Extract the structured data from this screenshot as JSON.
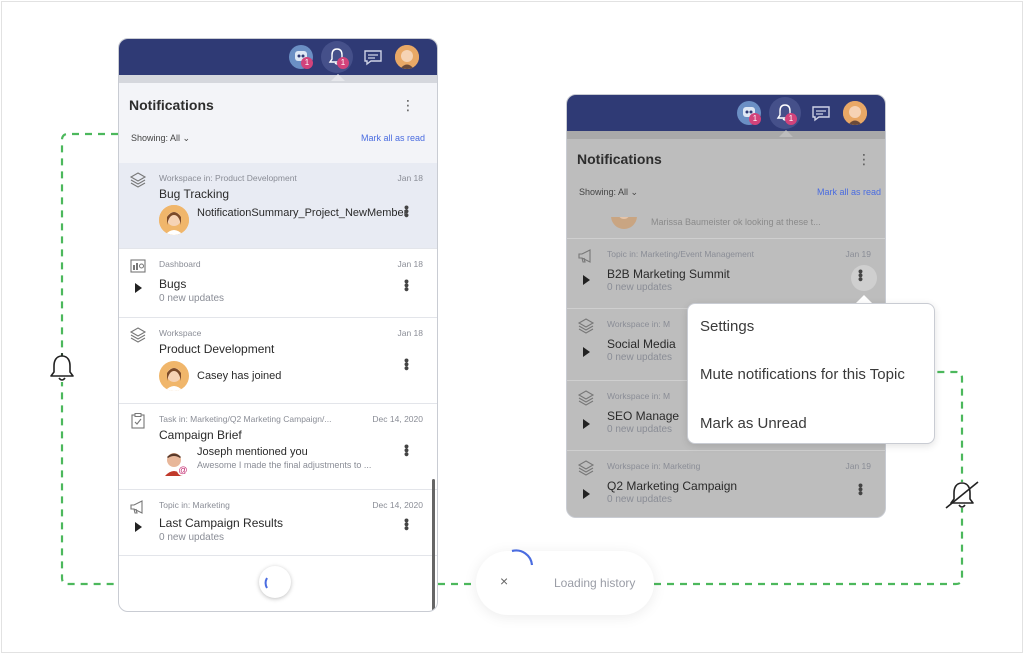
{
  "left_panel": {
    "topbar": {
      "bot_badge": "1",
      "bell_badge": "1"
    },
    "header": {
      "title": "Notifications",
      "showing": "Showing: All",
      "mark_all": "Mark all as read"
    },
    "items": [
      {
        "meta": "Workspace in: Product Development",
        "date": "Jan 18",
        "name": "Bug Tracking",
        "msg": "NotificationSummary_Project_NewMember"
      },
      {
        "meta": "Dashboard",
        "date": "Jan 18",
        "name": "Bugs",
        "sub": "0 new updates"
      },
      {
        "meta": "Workspace",
        "date": "Jan 18",
        "name": "Product Development",
        "msg": "Casey has joined"
      },
      {
        "meta": "Task in: Marketing/Q2 Marketing Campaign/...",
        "date": "Dec 14, 2020",
        "name": "Campaign Brief",
        "msg": "Joseph mentioned you",
        "msg2": "Awesome I made the final adjustments to ..."
      },
      {
        "meta": "Topic in: Marketing",
        "date": "Dec 14, 2020",
        "name": "Last Campaign Results",
        "sub": "0 new updates"
      }
    ]
  },
  "right_panel": {
    "topbar": {
      "bot_badge": "1",
      "bell_badge": "1"
    },
    "header": {
      "title": "Notifications",
      "showing": "Showing: All",
      "mark_all": "Mark all as read"
    },
    "partial_item": "Marissa Baumeister ok looking at these t...",
    "items": [
      {
        "meta": "Topic in: Marketing/Event Management",
        "date": "Jan 19",
        "name": "B2B Marketing Summit",
        "sub": "0 new updates"
      },
      {
        "meta": "Workspace in: M",
        "date": "",
        "name": "Social Media",
        "sub": "0 new updates"
      },
      {
        "meta": "Workspace in: M",
        "date": "",
        "name": "SEO Manage",
        "sub": "0 new updates"
      },
      {
        "meta": "Workspace in: Marketing",
        "date": "Jan 19",
        "name": "Q2 Marketing Campaign",
        "sub": "0 new updates"
      }
    ],
    "menu": {
      "settings": "Settings",
      "mute": "Mute notifications for this Topic",
      "mark_unread": "Mark as Unread"
    }
  },
  "loading": {
    "label": "Loading history",
    "close": "×"
  },
  "colors": {
    "topbar": "#2f3a75",
    "accent": "#4a6ce0",
    "badge": "#d2437b",
    "connector": "#4cb85c"
  }
}
